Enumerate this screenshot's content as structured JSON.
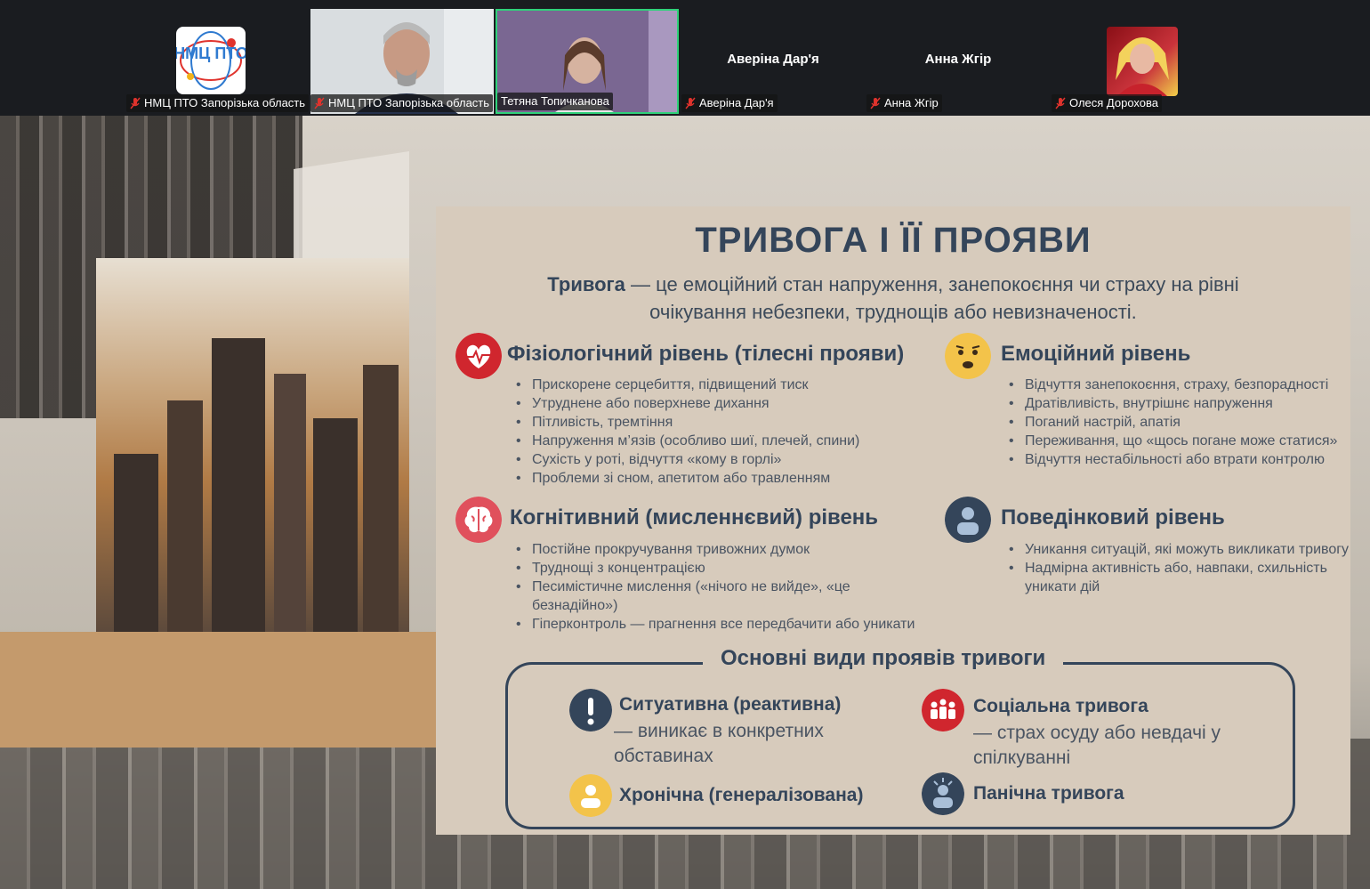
{
  "participants": [
    {
      "name": "НМЦ ПТО Запорізька область",
      "type": "logo"
    },
    {
      "name": "НМЦ ПТО Запорізька область",
      "type": "video"
    },
    {
      "name": "Тетяна Топичканова",
      "type": "video-active"
    },
    {
      "name": "Аверіна Дар'я",
      "type": "name-only"
    },
    {
      "name": "Анна Жгір",
      "type": "name-only"
    },
    {
      "name": "Олеся Дорохова",
      "type": "avatar"
    }
  ],
  "logo_text": "НМЦ ПТО",
  "slide": {
    "title": "ТРИВОГА І ЇЇ ПРОЯВИ",
    "definition_term": "Тривога",
    "definition_text": " — це емоційний стан напруження, занепокоєння чи страху на рівні очікування небезпеки, труднощів або невизначеності.",
    "sections": {
      "physio": {
        "title": "Фізіологічний рівень (тілесні прояви)",
        "items": [
          "Прискорене серцебиття, підвищений тиск",
          "Утруднене або поверхневе дихання",
          "Пітливість, тремтіння",
          "Напруження м’язів (особливо шиї, плечей, спини)",
          "Сухість у роті, відчуття «кому в горлі»",
          "Проблеми зі сном, апетитом або травленням"
        ]
      },
      "emotional": {
        "title": "Емоційний рівень",
        "items": [
          "Відчуття занепокоєння, страху, безпорадності",
          "Дратівливість, внутрішнє напруження",
          "Поганий настрій, апатія",
          "Переживання, що «щось погане може статися»",
          "Відчуття нестабільності або втрати контролю"
        ]
      },
      "cognitive": {
        "title": "Когнітивний (мисленнєвий) рівень",
        "items": [
          "Постійне прокручування тривожних думок",
          "Труднощі з концентрацією",
          "Песимістичне мислення («нічого не вийде», «це безнадійно»)",
          "Гіперконтроль — прагнення все передбачити або уникати"
        ]
      },
      "behavioral": {
        "title": "Поведінковий рівень",
        "items": [
          "Уникання ситуацій, які можуть викликати тривогу",
          "Надмірна активність або, навпаки, схильність уникати дій"
        ]
      }
    },
    "kinds_title": "Основні види проявів тривоги",
    "kinds": {
      "situational": {
        "title": "Ситуативна (реактивна)",
        "desc": " — виникає в конкретних обставинах"
      },
      "social": {
        "title": "Соціальна тривога",
        "desc": "— страх осуду або невдачі у спілкуванні"
      },
      "chronic": {
        "title": "Хронічна (генералізована)"
      },
      "panic": {
        "title": "Панічна тривога"
      }
    }
  },
  "colors": {
    "accent_red": "#d0262e",
    "navy": "#34455a",
    "yellow": "#f3c34a",
    "active_speaker": "#2fd27a",
    "card": "#d7cbbc"
  }
}
